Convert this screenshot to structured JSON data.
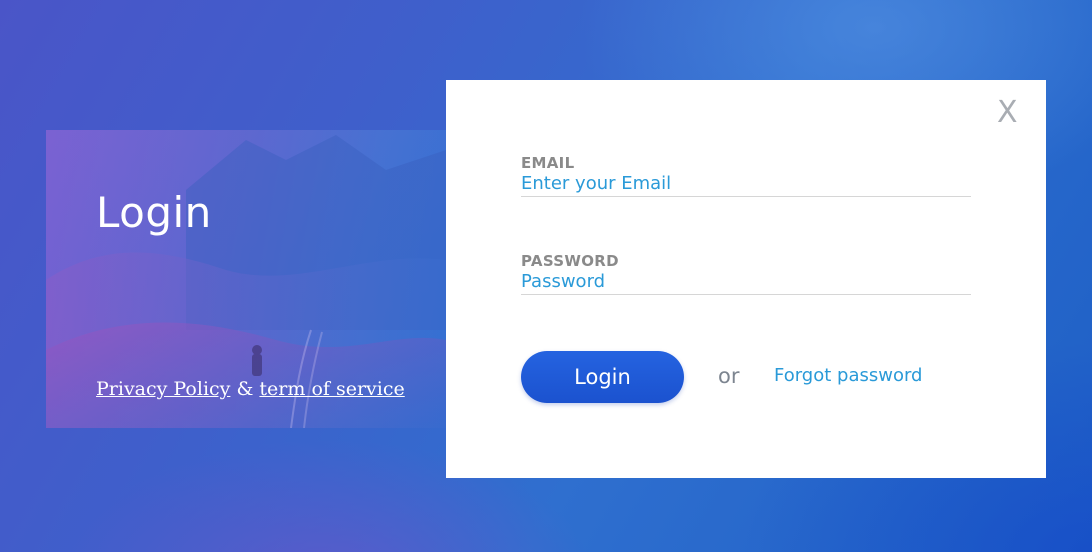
{
  "left_panel": {
    "title": "Login",
    "privacy_link": "Privacy Policy",
    "ampersand": "&",
    "terms_link": "term of service"
  },
  "modal": {
    "close_label": "X",
    "email": {
      "label": "EMAIL",
      "placeholder": "Enter your Email",
      "value": ""
    },
    "password": {
      "label": "PASSWORD",
      "placeholder": "Password",
      "value": ""
    },
    "login_button": "Login",
    "or_text": "or",
    "forgot_link": "Forgot password"
  },
  "colors": {
    "accent": "#2a9ad8",
    "button": "#1e58d6",
    "label": "#8a8a8a",
    "close": "#a9adb3"
  },
  "icons": {
    "close": "close-icon"
  }
}
